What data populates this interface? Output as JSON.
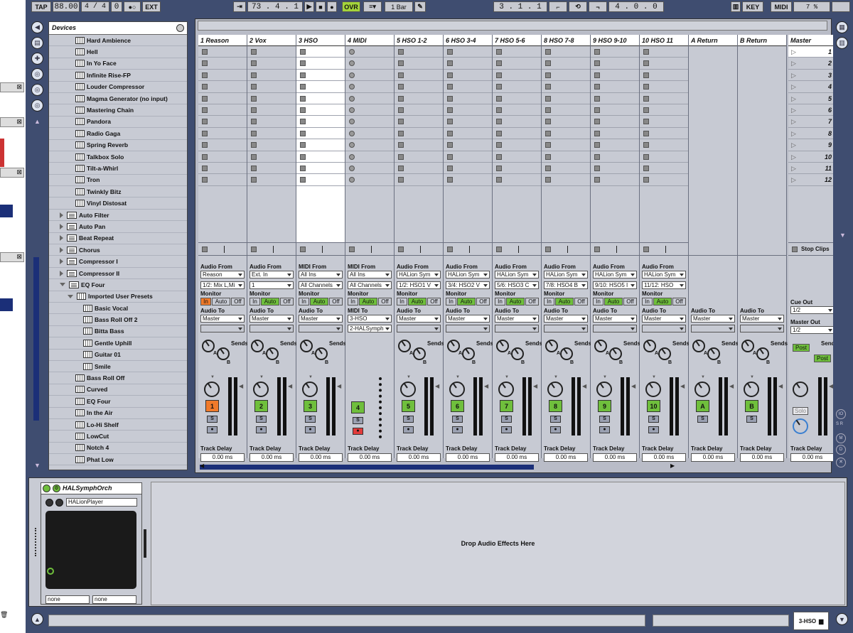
{
  "transport": {
    "tap": "TAP",
    "tempo": "88.00",
    "sig_num": "4",
    "sig_sep": "/",
    "sig_den": "4",
    "groove": "0",
    "metro": "●○",
    "ext": "EXT",
    "arrow": "⇥",
    "position": "73 .  4 .  1",
    "ovr": "OVR",
    "quant": "1 Bar",
    "loop_start": "3 .  1 .  1",
    "loop_len": "4 .  0 .  0",
    "key": "KEY",
    "midi": "MIDI",
    "cpu": "7 %"
  },
  "browser": {
    "title": "Devices",
    "items": [
      {
        "label": "Hard Ambience",
        "indent": 3,
        "kind": "file"
      },
      {
        "label": "Hell",
        "indent": 3,
        "kind": "file"
      },
      {
        "label": "In Yo Face",
        "indent": 3,
        "kind": "file"
      },
      {
        "label": "Infinite Rise-FP",
        "indent": 3,
        "kind": "file"
      },
      {
        "label": "Louder Compressor",
        "indent": 3,
        "kind": "file"
      },
      {
        "label": "Magma Generator (no input)",
        "indent": 3,
        "kind": "file"
      },
      {
        "label": "Mastering Chain",
        "indent": 3,
        "kind": "file"
      },
      {
        "label": "Pandora",
        "indent": 3,
        "kind": "file"
      },
      {
        "label": "Radio Gaga",
        "indent": 3,
        "kind": "file"
      },
      {
        "label": "Spring Reverb",
        "indent": 3,
        "kind": "file"
      },
      {
        "label": "Talkbox Solo",
        "indent": 3,
        "kind": "file"
      },
      {
        "label": "Tilt-a-Whirl",
        "indent": 3,
        "kind": "file"
      },
      {
        "label": "Tron",
        "indent": 3,
        "kind": "file"
      },
      {
        "label": "Twinkly Bitz",
        "indent": 3,
        "kind": "file"
      },
      {
        "label": "Vinyl Distosat",
        "indent": 3,
        "kind": "file"
      },
      {
        "label": "Auto Filter",
        "indent": 1,
        "kind": "plugin"
      },
      {
        "label": "Auto Pan",
        "indent": 1,
        "kind": "plugin"
      },
      {
        "label": "Beat Repeat",
        "indent": 1,
        "kind": "plugin"
      },
      {
        "label": "Chorus",
        "indent": 1,
        "kind": "plugin"
      },
      {
        "label": "Compressor I",
        "indent": 1,
        "kind": "plugin"
      },
      {
        "label": "Compressor II",
        "indent": 1,
        "kind": "plugin"
      },
      {
        "label": "EQ Four",
        "indent": 1,
        "kind": "plugin-open"
      },
      {
        "label": "Imported User Presets",
        "indent": 2,
        "kind": "folder-open"
      },
      {
        "label": "Basic Vocal",
        "indent": 4,
        "kind": "file"
      },
      {
        "label": "Bass Roll Off 2",
        "indent": 4,
        "kind": "file"
      },
      {
        "label": "Bitta Bass",
        "indent": 4,
        "kind": "file"
      },
      {
        "label": "Gentle Uphill",
        "indent": 4,
        "kind": "file"
      },
      {
        "label": "Guitar 01",
        "indent": 4,
        "kind": "file"
      },
      {
        "label": "Smile",
        "indent": 4,
        "kind": "file"
      },
      {
        "label": "Bass Roll Off",
        "indent": 3,
        "kind": "file"
      },
      {
        "label": "Curved",
        "indent": 3,
        "kind": "file"
      },
      {
        "label": "EQ Four",
        "indent": 3,
        "kind": "file"
      },
      {
        "label": "In the Air",
        "indent": 3,
        "kind": "file"
      },
      {
        "label": "Lo-Hi Shelf",
        "indent": 3,
        "kind": "file"
      },
      {
        "label": "LowCut",
        "indent": 3,
        "kind": "file"
      },
      {
        "label": "Notch 4",
        "indent": 3,
        "kind": "file"
      },
      {
        "label": "Phat Low",
        "indent": 3,
        "kind": "file"
      }
    ]
  },
  "labels": {
    "audio_from": "Audio From",
    "midi_from": "MIDI From",
    "monitor": "Monitor",
    "in": "In",
    "auto": "Auto",
    "off": "Off",
    "audio_to": "Audio To",
    "midi_to": "MIDI To",
    "sends": "Sends",
    "knob_a": "A",
    "knob_b": "B",
    "track_delay": "Track Delay",
    "delay_val": "0.00 ms",
    "solo_btn": "S",
    "arm_btn": "●",
    "stop_clips": "Stop Clips",
    "cue_out": "Cue Out",
    "master_out": "Master Out",
    "cue_val": "1/2",
    "master_out_val": "1/2",
    "post": "Post",
    "solo": "Solo"
  },
  "tracks": [
    {
      "name": "1 Reason",
      "num": "1",
      "type": "audio",
      "from": "Reason",
      "chan": "1/2: Mix L,Mi",
      "to": "Master",
      "monitor": "in",
      "act_color": "#f07a2a"
    },
    {
      "name": "2 Vox",
      "num": "2",
      "type": "audio",
      "from": "Ext. In",
      "chan": "1",
      "to": "Master",
      "monitor": "auto",
      "act_color": "#6fbf3c"
    },
    {
      "name": "3 HSO",
      "num": "3",
      "type": "midi",
      "from": "All Ins",
      "chan": "All Channels",
      "to": "Master",
      "monitor": "auto",
      "act_color": "#6fbf3c"
    },
    {
      "name": "4 MIDI",
      "num": "4",
      "type": "midiout",
      "from": "All Ins",
      "chan": "All Channels",
      "to": "3-HSO",
      "to2": "2-HALSymph",
      "monitor": "auto",
      "act_color": "#6fbf3c"
    },
    {
      "name": "5 HSO 1-2",
      "num": "5",
      "type": "audio",
      "from": "HALion Sym",
      "chan": "1/2: HSO1 V",
      "to": "Master",
      "monitor": "auto",
      "act_color": "#6fbf3c"
    },
    {
      "name": "6 HSO 3-4",
      "num": "6",
      "type": "audio",
      "from": "HALion Sym",
      "chan": "3/4: HSO2 V",
      "to": "Master",
      "monitor": "auto",
      "act_color": "#6fbf3c"
    },
    {
      "name": "7 HSO 5-6",
      "num": "7",
      "type": "audio",
      "from": "HALion Sym",
      "chan": "5/6: HSO3 C",
      "to": "Master",
      "monitor": "auto",
      "act_color": "#6fbf3c"
    },
    {
      "name": "8 HSO 7-8",
      "num": "8",
      "type": "audio",
      "from": "HALion Sym",
      "chan": "7/8: HSO4 B",
      "to": "Master",
      "monitor": "auto",
      "act_color": "#6fbf3c"
    },
    {
      "name": "9 HSO 9-10",
      "num": "9",
      "type": "audio",
      "from": "HALion Sym",
      "chan": "9/10: HSO5 I",
      "to": "Master",
      "monitor": "auto",
      "act_color": "#6fbf3c"
    },
    {
      "name": "10 HSO 11",
      "num": "10",
      "type": "audio",
      "from": "HALion Sym",
      "chan": "11/12: HSO",
      "to": "Master",
      "monitor": "auto",
      "act_color": "#6fbf3c"
    }
  ],
  "returns": [
    {
      "name": "A Return",
      "num": "A",
      "to": "Master"
    },
    {
      "name": "B Return",
      "num": "B",
      "to": "Master"
    }
  ],
  "master": {
    "name": "Master",
    "scenes": [
      "1",
      "2",
      "3",
      "4",
      "5",
      "6",
      "7",
      "8",
      "9",
      "10",
      "11",
      "12"
    ]
  },
  "device": {
    "name": "HALSymphOrch",
    "plugin": "HALionPlayer",
    "param1": "none",
    "param2": "none",
    "drop_hint": "Drop Audio Effects Here"
  },
  "bottom": {
    "track_label": "3-HSO"
  }
}
